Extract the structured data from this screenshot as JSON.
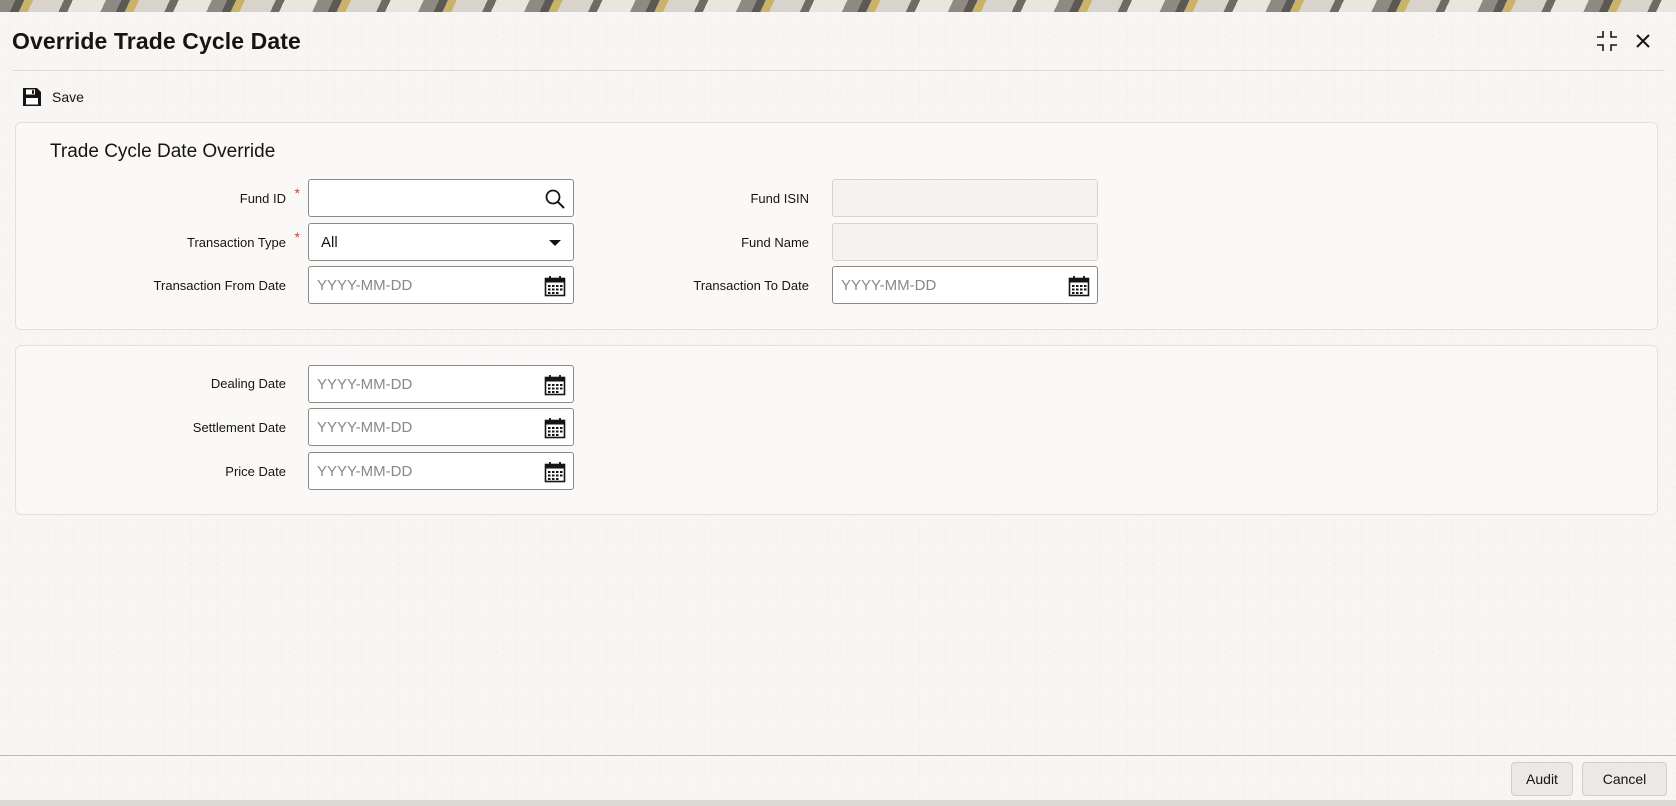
{
  "window": {
    "title": "Override Trade Cycle Date",
    "maximize_icon": "maximize-icon",
    "close_icon": "close-icon"
  },
  "toolbar": {
    "save_label": "Save",
    "save_icon": "floppy-disk-icon"
  },
  "section1": {
    "title": "Trade Cycle Date Override",
    "fund_id": {
      "label": "Fund ID",
      "required": "*",
      "value": "",
      "icon": "search-icon"
    },
    "transaction_type": {
      "label": "Transaction Type",
      "required": "*",
      "value": "All",
      "icon": "caret-down-icon"
    },
    "transaction_from_date": {
      "label": "Transaction From Date",
      "placeholder": "YYYY-MM-DD",
      "icon": "calendar-icon"
    },
    "fund_isin": {
      "label": "Fund ISIN",
      "value": ""
    },
    "fund_name": {
      "label": "Fund Name",
      "value": ""
    },
    "transaction_to_date": {
      "label": "Transaction To Date",
      "placeholder": "YYYY-MM-DD",
      "icon": "calendar-icon"
    }
  },
  "section2": {
    "dealing_date": {
      "label": "Dealing Date",
      "placeholder": "YYYY-MM-DD",
      "icon": "calendar-icon"
    },
    "settlement_date": {
      "label": "Settlement Date",
      "placeholder": "YYYY-MM-DD",
      "icon": "calendar-icon"
    },
    "price_date": {
      "label": "Price Date",
      "placeholder": "YYYY-MM-DD",
      "icon": "calendar-icon"
    }
  },
  "footer": {
    "audit_label": "Audit",
    "cancel_label": "Cancel"
  },
  "colors": {
    "required_marker": "#c74634",
    "text": "#161513",
    "field_border": "#8c8a86"
  }
}
